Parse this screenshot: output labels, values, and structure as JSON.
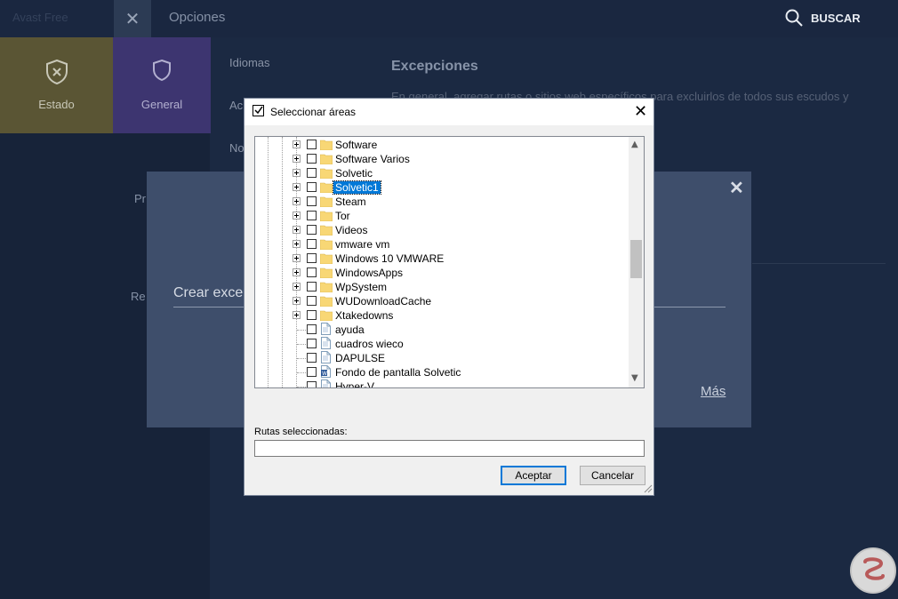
{
  "app": {
    "brand": "Avast Free",
    "options_title": "Opciones",
    "search_label": "BUSCAR",
    "tiles": [
      {
        "label": "Estado",
        "icon": "shield-x-icon"
      },
      {
        "label": "General",
        "icon": "shield-icon"
      }
    ],
    "nav": [
      "Idiomas",
      "Ac",
      "No"
    ],
    "section_title": "Excepciones",
    "section_desc": "En general, agregar rutas o sitios web específicos para excluirlos de todos sus escudos y",
    "side_fragments": {
      "pr": "Pr",
      "re": "Re"
    }
  },
  "overlay": {
    "create_text": "Crear excep",
    "more_link": "Más",
    "close_symbol": "✕"
  },
  "dialog": {
    "title": "Seleccionar áreas",
    "close_symbol": "✕",
    "tree_items": [
      {
        "label": "Software",
        "kind": "folder",
        "expandable": true
      },
      {
        "label": "Software Varios",
        "kind": "folder",
        "expandable": true
      },
      {
        "label": "Solvetic",
        "kind": "folder",
        "expandable": true
      },
      {
        "label": "Solvetic1",
        "kind": "folder",
        "expandable": true,
        "selected": true
      },
      {
        "label": "Steam",
        "kind": "folder",
        "expandable": true
      },
      {
        "label": "Tor",
        "kind": "folder",
        "expandable": true
      },
      {
        "label": "Videos",
        "kind": "folder",
        "expandable": true
      },
      {
        "label": "vmware vm",
        "kind": "folder",
        "expandable": true
      },
      {
        "label": "Windows 10 VMWARE",
        "kind": "folder",
        "expandable": true
      },
      {
        "label": "WindowsApps",
        "kind": "folder",
        "expandable": true
      },
      {
        "label": "WpSystem",
        "kind": "folder",
        "expandable": true
      },
      {
        "label": "WUDownloadCache",
        "kind": "folder",
        "expandable": true
      },
      {
        "label": "Xtakedowns",
        "kind": "folder",
        "expandable": true
      },
      {
        "label": "ayuda",
        "kind": "file",
        "expandable": false
      },
      {
        "label": "cuadros wieco",
        "kind": "file",
        "expandable": false
      },
      {
        "label": "DAPULSE",
        "kind": "file",
        "expandable": false
      },
      {
        "label": "Fondo de pantalla Solvetic",
        "kind": "word-file",
        "expandable": false
      },
      {
        "label": "Hyper-V",
        "kind": "file",
        "expandable": false
      }
    ],
    "selected_paths_label": "Rutas seleccionadas:",
    "selected_paths_value": "",
    "accept_label": "Aceptar",
    "cancel_label": "Cancelar"
  },
  "colors": {
    "selection": "#0078d7",
    "folder": "#f8d775",
    "panel": "#3e4e6b"
  }
}
